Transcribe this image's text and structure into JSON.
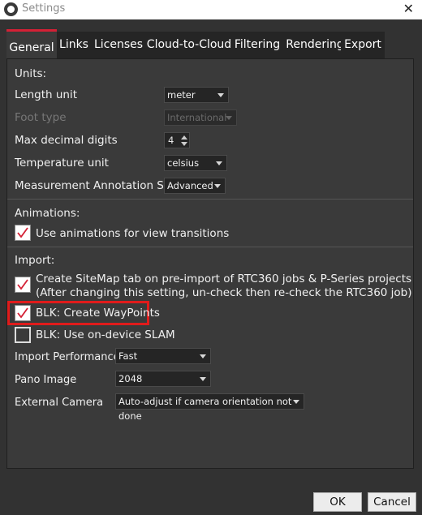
{
  "window": {
    "title": "Settings",
    "close_glyph": "✕",
    "icon": "app-logo-icon"
  },
  "tabs": [
    {
      "label": "General",
      "active": true
    },
    {
      "label": "Links"
    },
    {
      "label": "Licenses"
    },
    {
      "label": "Cloud-to-Cloud"
    },
    {
      "label": "Filtering"
    },
    {
      "label": "Rendering"
    },
    {
      "label": "Export"
    }
  ],
  "units": {
    "heading": "Units:",
    "length_unit": {
      "label": "Length unit",
      "value": "meter"
    },
    "foot_type": {
      "label": "Foot type",
      "value": "International",
      "disabled": true
    },
    "max_decimal": {
      "label": "Max decimal digits",
      "value": "4"
    },
    "temperature": {
      "label": "Temperature unit",
      "value": "celsius"
    },
    "annotation_style": {
      "label": "Measurement Annotation Style",
      "value": "Advanced"
    }
  },
  "animations": {
    "heading": "Animations:",
    "use_animations": {
      "label": "Use animations for view transitions",
      "checked": true
    }
  },
  "import": {
    "heading": "Import:",
    "sitemap": {
      "line1": "Create SiteMap tab on pre-import of RTC360 jobs & P-Series projects",
      "line2": "(After changing this setting, un-check then re-check the RTC360 job)",
      "checked": true
    },
    "waypoints": {
      "label": "BLK: Create WayPoints",
      "checked": true,
      "highlighted": true
    },
    "slam": {
      "label": "BLK: Use on-device SLAM",
      "checked": false
    },
    "performance": {
      "label": "Import Performance",
      "value": "Fast"
    },
    "pano": {
      "label": "Pano Image",
      "value": "2048"
    },
    "camera": {
      "label": "External Camera",
      "value": "Auto-adjust if camera orientation not done"
    }
  },
  "buttons": {
    "ok": "OK",
    "cancel": "Cancel"
  },
  "colors": {
    "accent": "#d42035",
    "highlight": "#e01b1b",
    "background": "#323232",
    "panel": "#3a3a3a"
  }
}
